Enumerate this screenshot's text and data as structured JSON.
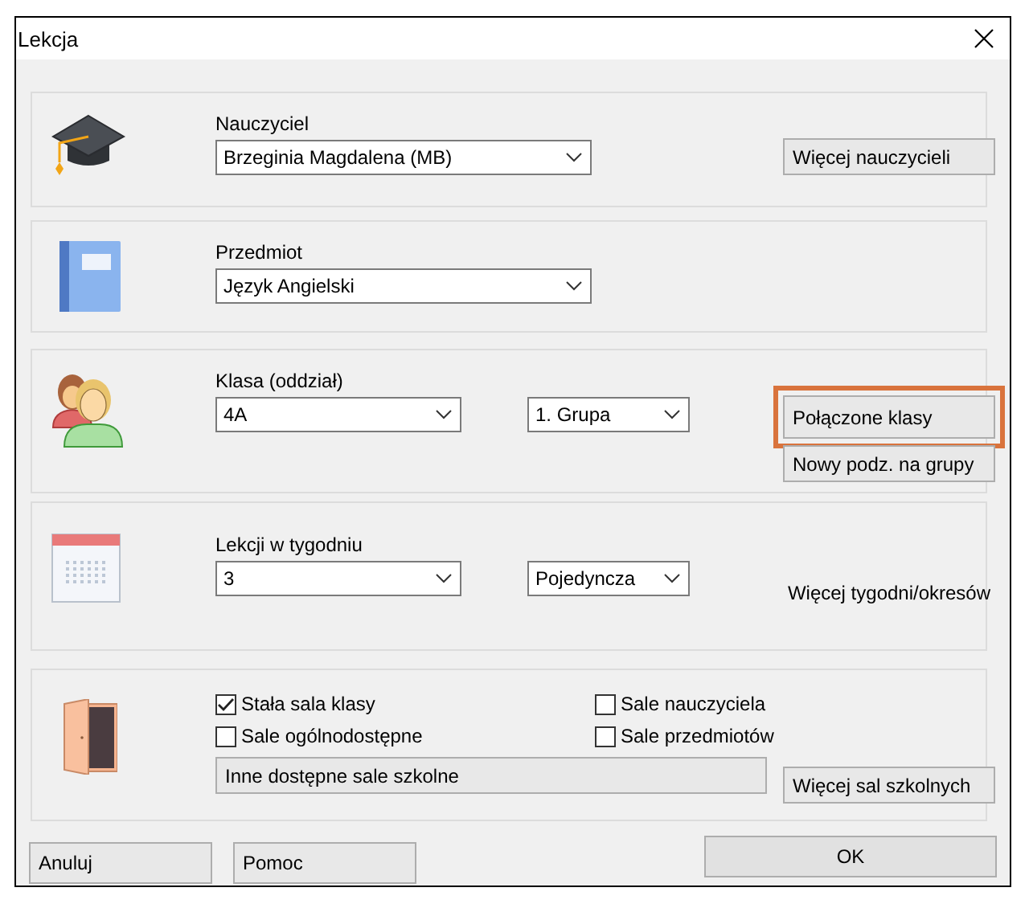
{
  "window": {
    "title": "Lekcja"
  },
  "sections": [
    {
      "kind": "teacher",
      "label": "Nauczyciel",
      "selects": [
        {
          "value": "Brzeginia Magdalena (MB)"
        }
      ],
      "buttons": [
        {
          "label": "Więcej nauczycieli",
          "highlighted": false
        }
      ]
    },
    {
      "kind": "subject",
      "label": "Przedmiot",
      "selects": [
        {
          "value": "Język Angielski"
        }
      ]
    },
    {
      "kind": "class",
      "label": "Klasa (oddział)",
      "selects": [
        {
          "value": "4A"
        },
        {
          "value": "1. Grupa"
        }
      ],
      "buttons": [
        {
          "label": "Połączone klasy",
          "highlighted": true
        },
        {
          "label": "Nowy podz. na grupy",
          "highlighted": false
        }
      ]
    },
    {
      "kind": "lessons",
      "label": "Lekcji w tygodniu",
      "selects": [
        {
          "value": "3"
        },
        {
          "value": "Pojedyncza"
        }
      ],
      "note": "Więcej tygodni/okresów"
    },
    {
      "kind": "rooms",
      "checkboxes": [
        {
          "label": "Stała sala klasy",
          "checked": true
        },
        {
          "label": "Sale nauczyciela",
          "checked": false
        },
        {
          "label": "Sale ogólnodostępne",
          "checked": false
        },
        {
          "label": "Sale przedmiotów",
          "checked": false
        }
      ],
      "wide_button": "Inne dostępne sale szkolne",
      "buttons": [
        {
          "label": "Więcej sal szkolnych",
          "highlighted": false
        }
      ]
    }
  ],
  "footer": {
    "buttons": [
      {
        "label": "Anuluj",
        "kind": "plain"
      },
      {
        "label": "Pomoc",
        "kind": "plain"
      },
      {
        "label": "OK",
        "kind": "default"
      }
    ]
  }
}
